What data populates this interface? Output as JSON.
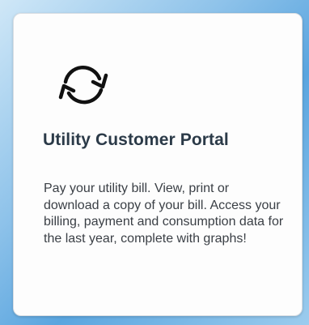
{
  "card": {
    "icon": "refresh-sync-icon",
    "title": "Utility Customer Portal",
    "description": "Pay your utility bill. View, print or download a copy of your bill. Access your billing, payment and consumption data for the last year, complete with graphs!"
  },
  "colors": {
    "title": "#2b3a48",
    "text": "#3a3f45",
    "card_background": "#fdfdfd"
  }
}
